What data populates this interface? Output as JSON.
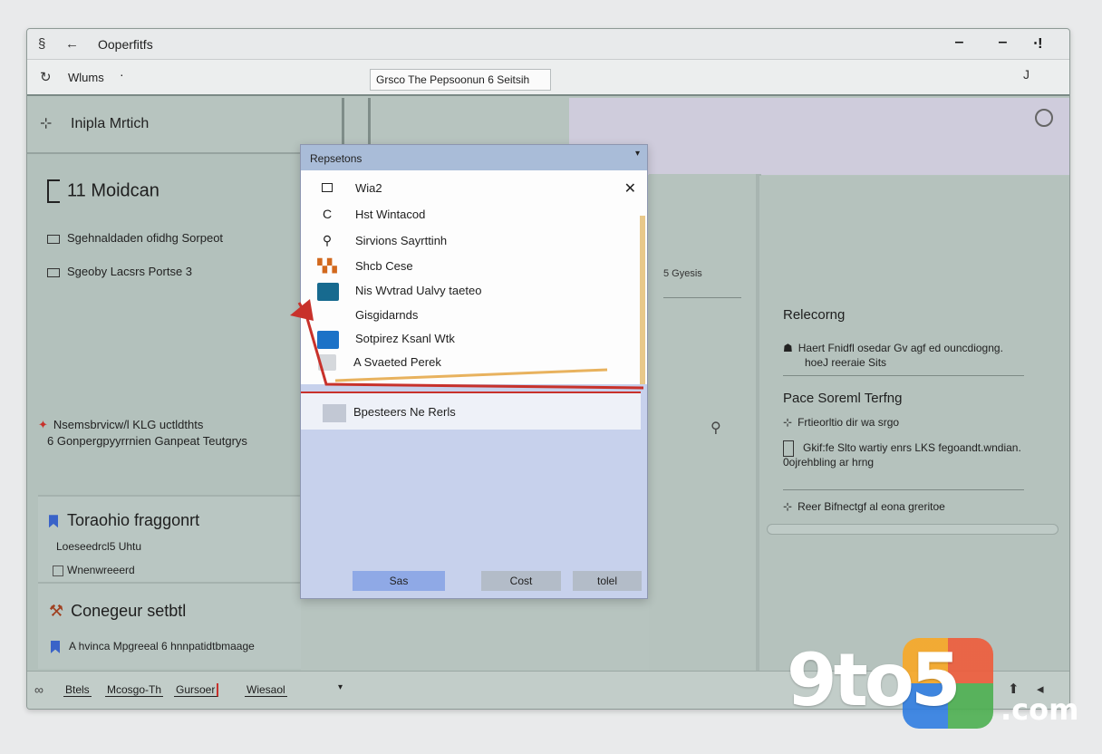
{
  "window": {
    "title": "Ooperfitfs",
    "controls": [
      "‒",
      "‒",
      "⋅!"
    ]
  },
  "toolbar": {
    "label": "Wlums",
    "address": "Grsco  The Pepsoonun 6 Seitsih",
    "extra": "J"
  },
  "left_panel": {
    "header": "Inipla Mrtich",
    "title": "11 Moidcan",
    "rows": [
      "Sgehnaldaden ofidhg Sorpeot",
      "Sgeoby Lacsrs Portse 3"
    ],
    "note": [
      "Nsemsbrvicw/l KLG uctldthts",
      "6 Gonpergpyyrrnien Ganpeat Teutgrys"
    ],
    "card1": {
      "title": "Toraohio fraggonrt",
      "sub": "Loeseedrcl5 Uhtu",
      "check": "Wnenwreeerd"
    },
    "card2": {
      "title": "Conegeur setbtl",
      "sub": "A hvinca Mpgreeal 6 hnnpatidtbmaage"
    }
  },
  "center": {
    "label": "5 Gyesis"
  },
  "right_panel": {
    "section1": {
      "title": "Relecorng",
      "text": [
        "Haert Fnidfl osedar Gv agf ed ouncdiogng.",
        "hoeJ reeraie Sits"
      ]
    },
    "section2": {
      "title": "Pace Soreml Terfng",
      "items": [
        "Frtieorltio dir wa srgo",
        "Gkif:fe Slto wartiy enrs LKS fegoandt.wndian.",
        "0ojrehbling ar hrng"
      ]
    },
    "section3": {
      "item": "Reer Bifnectgf al eona greritoe"
    }
  },
  "dialog": {
    "title": "Repsetons",
    "items": [
      {
        "icon": "square-icon",
        "label": "Wia2"
      },
      {
        "icon": "refresh-icon",
        "label": "Hst Wintacod"
      },
      {
        "icon": "search-icon",
        "label": "Sirvions Sayrttinh"
      },
      {
        "icon": "chart-icon",
        "label": "Shcb Cese"
      },
      {
        "icon": "teal-app-icon",
        "label": "Nis Wvtrad Ualvy taeteo"
      },
      {
        "icon": "none",
        "label": "Gisgidarnds"
      },
      {
        "icon": "blue-app-icon",
        "label": "Sotpirez Ksanl Wtk"
      },
      {
        "icon": "grey-app-icon",
        "label": "A Svaeted Perek"
      }
    ],
    "selected": "Bpesteers Ne Rerls",
    "buttons": {
      "primary": "Sas",
      "middle": "Cost",
      "right": "tolel"
    }
  },
  "statusbar": {
    "tabs": [
      "Btels",
      "Mcosgo-Th",
      "Gursoer",
      "Wiesaol"
    ]
  },
  "watermark": {
    "brand": "9to5",
    "suffix": ".com"
  },
  "colors": {
    "accent": "#c8312b",
    "dialog_bg": "#c7d1ec",
    "window_bg": "#b7c4bf"
  }
}
